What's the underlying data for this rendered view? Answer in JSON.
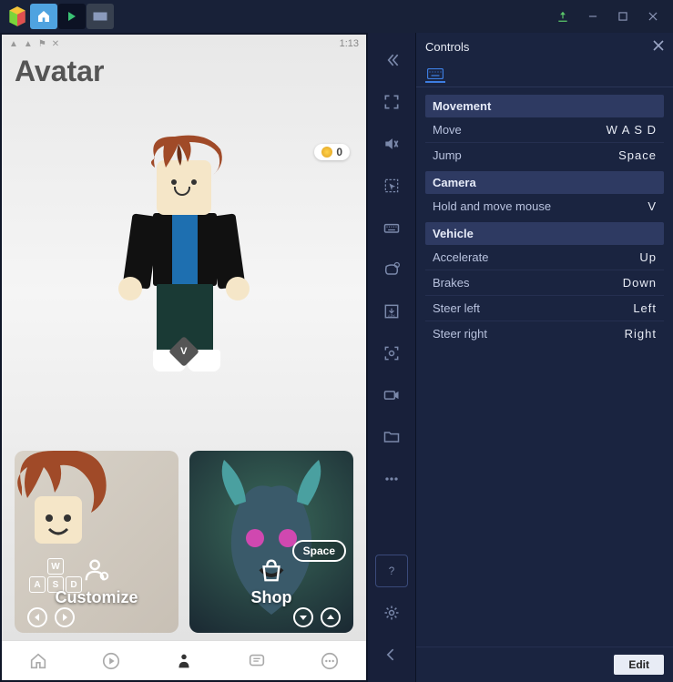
{
  "titlebar": {
    "tooltip_upload": "Upload",
    "tooltip_min": "Minimize",
    "tooltip_max": "Maximize",
    "tooltip_close": "Close"
  },
  "game": {
    "time": "1:13",
    "title": "Avatar",
    "currency_value": "0",
    "v_key": "V",
    "cards": {
      "customize": {
        "label": "Customize",
        "keys": {
          "w": "W",
          "a": "A",
          "s": "S",
          "d": "D"
        }
      },
      "shop": {
        "label": "Shop",
        "space_label": "Space"
      }
    }
  },
  "panel": {
    "title": "Controls",
    "edit_label": "Edit",
    "sections": [
      {
        "heading": "Movement",
        "rows": [
          {
            "label": "Move",
            "key": "W A S D"
          },
          {
            "label": "Jump",
            "key": "Space"
          }
        ]
      },
      {
        "heading": "Camera",
        "rows": [
          {
            "label": "Hold and move mouse",
            "key": "V"
          }
        ]
      },
      {
        "heading": "Vehicle",
        "rows": [
          {
            "label": "Accelerate",
            "key": "Up"
          },
          {
            "label": "Brakes",
            "key": "Down"
          },
          {
            "label": "Steer left",
            "key": "Left"
          },
          {
            "label": "Steer right",
            "key": "Right"
          }
        ]
      }
    ]
  }
}
